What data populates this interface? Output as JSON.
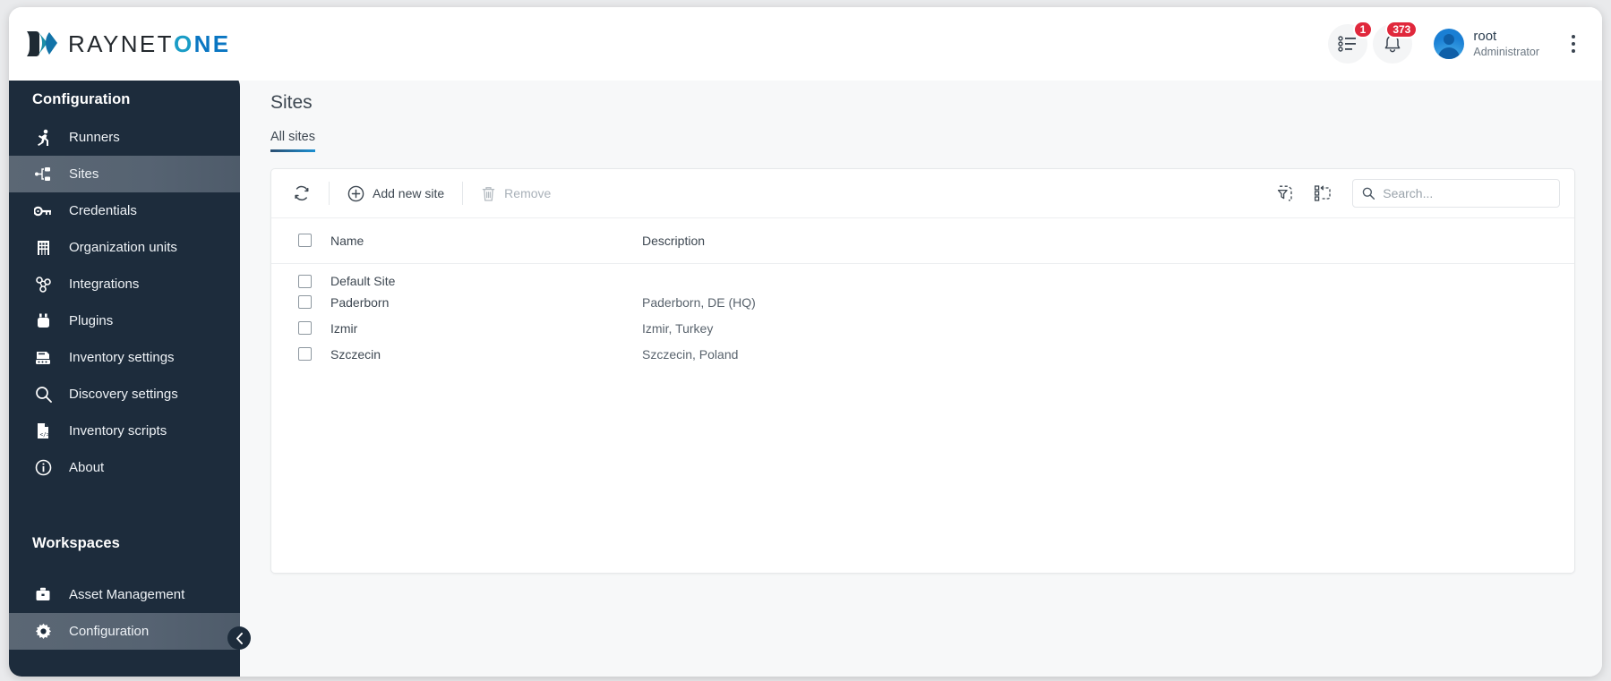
{
  "brand": {
    "prefix": "RAYNET",
    "o": "O",
    "ne": "NE",
    "logo_icon": "raynet-logo-icon"
  },
  "header": {
    "tasks": {
      "icon": "task-list-icon",
      "badge": "1"
    },
    "notifications": {
      "icon": "bell-icon",
      "badge": "373"
    },
    "user": {
      "name": "root",
      "role": "Administrator",
      "avatar_icon": "user-avatar-icon"
    },
    "more": {
      "icon": "kebab-menu-icon"
    }
  },
  "sidebar": {
    "section_title": "Configuration",
    "items": [
      {
        "label": "Runners",
        "icon": "runner-icon",
        "active": false
      },
      {
        "label": "Sites",
        "icon": "sites-icon",
        "active": true
      },
      {
        "label": "Credentials",
        "icon": "key-icon",
        "active": false
      },
      {
        "label": "Organization units",
        "icon": "building-icon",
        "active": false
      },
      {
        "label": "Integrations",
        "icon": "integrations-icon",
        "active": false
      },
      {
        "label": "Plugins",
        "icon": "plugin-icon",
        "active": false
      },
      {
        "label": "Inventory settings",
        "icon": "inventory-settings-icon",
        "active": false
      },
      {
        "label": "Discovery settings",
        "icon": "search-icon",
        "active": false
      },
      {
        "label": "Inventory scripts",
        "icon": "script-file-icon",
        "active": false
      },
      {
        "label": "About",
        "icon": "info-icon",
        "active": false
      }
    ],
    "workspaces_title": "Workspaces",
    "workspaces": [
      {
        "label": "Asset Management",
        "icon": "briefcase-icon",
        "active": false
      },
      {
        "label": "Configuration",
        "icon": "gear-icon",
        "active": true
      }
    ],
    "collapse": {
      "icon": "chevron-left-icon"
    }
  },
  "main": {
    "page_title": "Sites",
    "tabs": [
      {
        "label": "All sites",
        "active": true
      }
    ],
    "toolbar": {
      "refresh": {
        "label": "",
        "icon": "refresh-icon"
      },
      "add": {
        "label": "Add new site",
        "icon": "plus-circle-icon"
      },
      "remove": {
        "label": "Remove",
        "icon": "trash-icon",
        "disabled": true
      },
      "clear_filter": {
        "icon": "clear-filter-icon"
      },
      "reset_layout": {
        "icon": "reset-columns-icon"
      },
      "search": {
        "placeholder": "Search...",
        "value": "",
        "icon": "search-icon"
      }
    },
    "table": {
      "select_all": {
        "icon": "checkbox-icon",
        "checked": false
      },
      "columns": [
        "Name",
        "Description"
      ],
      "rows": [
        {
          "checked": false,
          "name": "Default Site",
          "description": ""
        },
        {
          "checked": false,
          "name": "Paderborn",
          "description": "Paderborn, DE (HQ)"
        },
        {
          "checked": false,
          "name": "Izmir",
          "description": "Izmir, Turkey"
        },
        {
          "checked": false,
          "name": "Szczecin",
          "description": "Szczecin, Poland"
        }
      ]
    }
  },
  "colors": {
    "accent": "#1b8fd1",
    "sidebar": "#1d2c3c",
    "badge": "#e0283c"
  }
}
